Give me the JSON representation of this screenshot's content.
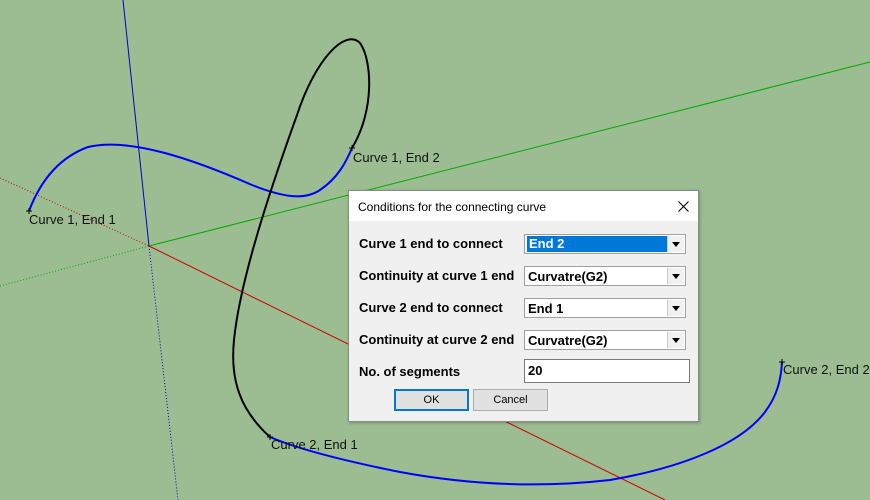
{
  "viewport": {
    "labels": {
      "c1e1": "Curve 1, End 1",
      "c1e2": "Curve 1, End 2",
      "c2e1": "Curve 2, End 1",
      "c2e2": "Curve 2, End 2"
    },
    "colors": {
      "background": "#9bbd91",
      "curve": "#0000ff",
      "connecting_curve": "#000000",
      "axis_x": "#cc0000",
      "axis_y": "#00aa00",
      "axis_z": "#0000cc"
    }
  },
  "dialog": {
    "title": "Conditions for the connecting curve",
    "rows": [
      {
        "label": "Curve 1 end to connect",
        "value": "End 2"
      },
      {
        "label": "Continuity at curve 1 end",
        "value": "Curvatre(G2)"
      },
      {
        "label": "Curve 2 end to connect",
        "value": "End 1"
      },
      {
        "label": "Continuity at curve 2 end",
        "value": "Curvatre(G2)"
      }
    ],
    "segments_label": "No. of segments",
    "segments_value": "20",
    "ok_label": "OK",
    "cancel_label": "Cancel"
  }
}
